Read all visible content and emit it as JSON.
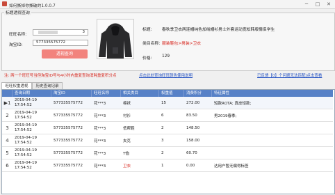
{
  "window": {
    "title": "如何撕掉你撕破的1.0.0.7",
    "minimize": "─",
    "maximize": "□",
    "close": "✕"
  },
  "group": {
    "title": "标题透视查询"
  },
  "form": {
    "wangwang_label": "旺旺名称:",
    "wangwang_value": "3",
    "taobao_id_label": "淘宝ID:",
    "taobao_id_value": "577335575772",
    "query_button": "透视查询"
  },
  "product": {
    "title_label": "标题:",
    "title_value": "春秋季卫衣两连帽纯色加绒帽衫男士外套运动宽松韩版情侣学生",
    "keyword_label": "类目名称:",
    "keyword_value": "服装鞋包>男装>卫衣",
    "price_label": "价格:",
    "price_value": "129"
  },
  "notes": {
    "left_note": "注: 两一个旺旺号当但淘宝ID号与4小时内重复查询消耗重复积分点",
    "left_link": "点击此处查询旺旺颜色使用说明",
    "right_note": "已反馈【0】个问题无法匹配|点击查看"
  },
  "tabs": [
    {
      "label": "旺旺权重透视"
    },
    {
      "label": "历史查询记录"
    }
  ],
  "table": {
    "columns": [
      "查询日期",
      "淘宝ID",
      "旺旺名称",
      "相关类目",
      "权重值",
      "消费积分",
      "特征属性"
    ],
    "rows": [
      {
        "marker": "▶1",
        "date": "2019-04-19",
        "time": "17:54:52",
        "id": "577335575772",
        "name": "花***3",
        "category": "棉袄",
        "weight": "15",
        "points": "272.00",
        "feature": "短款ROTA; 真皮短款;",
        "category_red": false
      },
      {
        "marker": "2",
        "date": "2019-04-19",
        "time": "17:54:52",
        "id": "577335575772",
        "name": "花***3",
        "category": "衬衫",
        "weight": "6",
        "points": "83.50",
        "feature": "男2019春季;",
        "category_red": false
      },
      {
        "marker": "3",
        "date": "2019-04-19",
        "time": "17:54:52",
        "id": "577335575772",
        "name": "花***3",
        "category": "低帮鞋",
        "weight": "2",
        "points": "148.50",
        "feature": "",
        "category_red": false
      },
      {
        "marker": "4",
        "date": "2019-04-19",
        "time": "17:54:52",
        "id": "577335575772",
        "name": "花***3",
        "category": "夹克",
        "weight": "3",
        "points": "158.00",
        "feature": "",
        "category_red": false
      },
      {
        "marker": "5",
        "date": "2019-04-19",
        "time": "17:54:52",
        "id": "577335575772",
        "name": "花***3",
        "category": "T恤",
        "weight": "2",
        "points": "60.70",
        "feature": "",
        "category_red": false
      },
      {
        "marker": "6",
        "date": "2019-04-19",
        "time": "17:54:52",
        "id": "577335575772",
        "name": "花***3",
        "category": "卫衣",
        "weight": "1",
        "points": "0.00",
        "feature": "达用户暂无偏得标签",
        "category_red": true
      }
    ]
  },
  "colors": {
    "accent_red": "#d7251c",
    "button_pink": "#f2837d",
    "header_blue": "#5781c7",
    "link_blue": "#1f4ec2"
  }
}
